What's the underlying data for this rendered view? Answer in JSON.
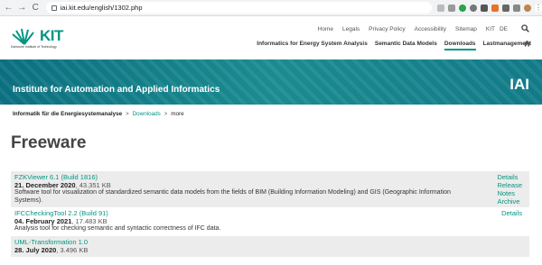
{
  "browser": {
    "url": "iai.kit.edu/english/1302.php",
    "back": "←",
    "forward": "→",
    "reload": "C"
  },
  "header": {
    "logo_name": "KIT",
    "logo_subtitle": "Karlsruhe Institute of Technology",
    "top_links": [
      "Home",
      "Legals",
      "Privacy Policy",
      "Accessibility",
      "Sitemap",
      "KIT"
    ],
    "lang": "DE",
    "nav": [
      "Informatics for Energy System Analysis",
      "Semantic Data Models",
      "Downloads",
      "Lastmanagement"
    ]
  },
  "banner": {
    "title": "Institute for Automation and Applied Informatics",
    "abbr": "IAI"
  },
  "breadcrumb": {
    "root": "Informatik für die Energiesystemanalyse",
    "link": "Downloads",
    "current": "more",
    "sep": ">"
  },
  "page": {
    "title": "Freeware"
  },
  "items": [
    {
      "title": "FZKViewer 6.1 (Build 1816)",
      "date": "21. December 2020",
      "size": ", 43.351 KB",
      "desc": "Software tool for visualization of standardized semantic data models from the fields of BIM (Building Information Modeling) and GIS (Geographic Information Systems).",
      "actions": [
        "Details",
        "Release",
        "Notes",
        "Archive"
      ]
    },
    {
      "title": "IFCCheckingTool 2.2 (Build 91)",
      "date": "04. February 2021",
      "size": ", 17.483 KB",
      "desc": "Analysis tool for checking semantic and syntactic correctness of IFC data.",
      "actions": [
        "Details"
      ]
    },
    {
      "title": "UML-Transformation 1.0",
      "date": "28. July 2020",
      "size": ", 3.496 KB",
      "desc": "",
      "actions": []
    }
  ],
  "colors": {
    "accent": "#009682",
    "banner": "#1a8c90"
  }
}
